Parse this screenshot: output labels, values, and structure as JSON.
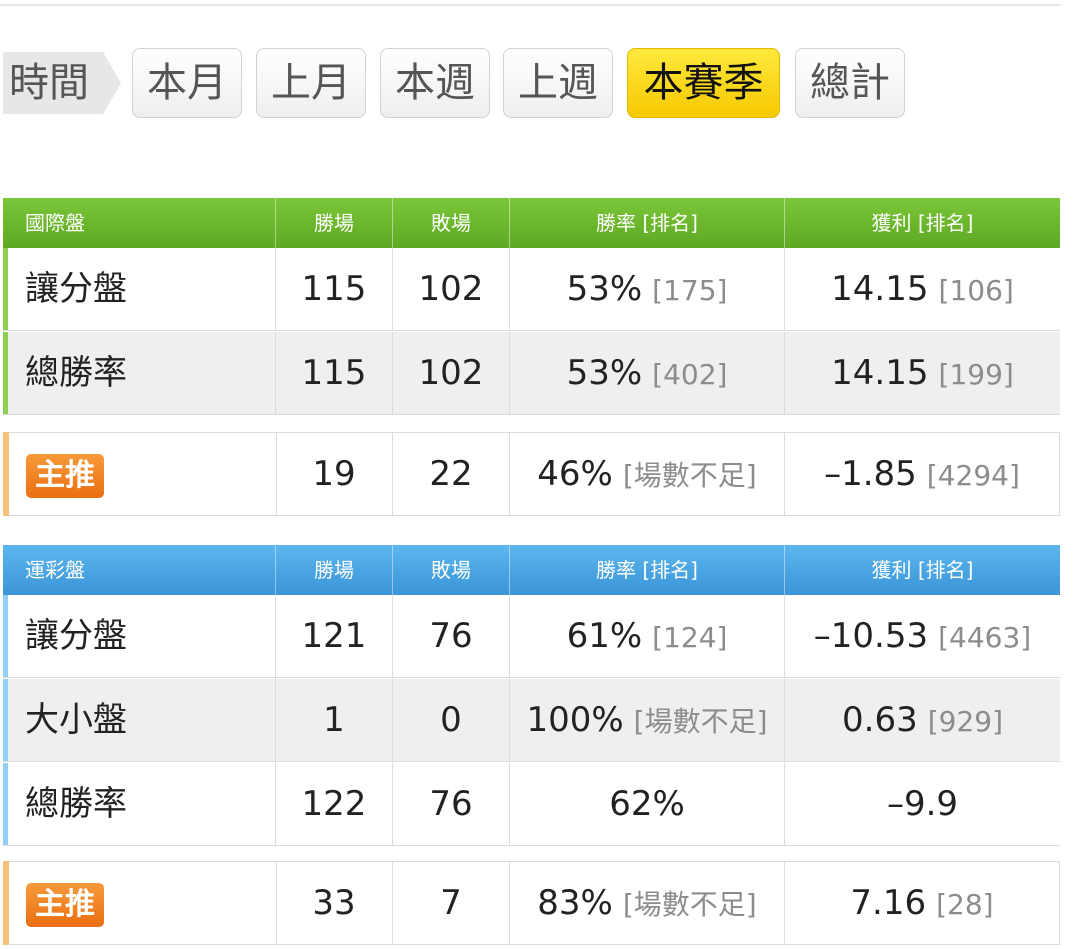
{
  "tabs": {
    "time_label": "時間",
    "items": [
      "本月",
      "上月",
      "本週",
      "上週",
      "本賽季",
      "總計"
    ],
    "active": "本賽季"
  },
  "tables": [
    {
      "header": [
        "國際盤",
        "勝場",
        "敗場",
        "勝率 [排名]",
        "獲利 [排名]"
      ],
      "color": "#6cb62e",
      "accent": "#8dd050",
      "rows": [
        {
          "label": "讓分盤",
          "wins": "115",
          "losses": "102",
          "rate": "53%",
          "rate_rank": "[175]",
          "profit": "14.15",
          "profit_rank": "[106]"
        },
        {
          "label": "總勝率",
          "wins": "115",
          "losses": "102",
          "rate": "53%",
          "rate_rank": "[402]",
          "profit": "14.15",
          "profit_rank": "[199]"
        }
      ],
      "featured": {
        "label": "主推",
        "wins": "19",
        "losses": "22",
        "rate": "46%",
        "rate_rank": "[場數不足]",
        "profit": "–1.85",
        "profit_rank": "[4294]"
      }
    },
    {
      "header": [
        "運彩盤",
        "勝場",
        "敗場",
        "勝率 [排名]",
        "獲利 [排名]"
      ],
      "color": "#4aa5e4",
      "accent": "#8fd0f4",
      "rows": [
        {
          "label": "讓分盤",
          "wins": "121",
          "losses": "76",
          "rate": "61%",
          "rate_rank": "[124]",
          "profit": "–10.53",
          "profit_rank": "[4463]"
        },
        {
          "label": "大小盤",
          "wins": "1",
          "losses": "0",
          "rate": "100%",
          "rate_rank": "[場數不足]",
          "profit": "0.63",
          "profit_rank": "[929]"
        },
        {
          "label": "總勝率",
          "wins": "122",
          "losses": "76",
          "rate": "62%",
          "rate_rank": "",
          "profit": "–9.9",
          "profit_rank": ""
        }
      ],
      "featured": {
        "label": "主推",
        "wins": "33",
        "losses": "7",
        "rate": "83%",
        "rate_rank": "[場數不足]",
        "profit": "7.16",
        "profit_rank": "[28]"
      }
    }
  ],
  "colors": {
    "active_tab": "#f6c900",
    "green_header": "#6cb62e",
    "blue_header": "#4aa5e4",
    "featured_badge": "#ea6f11",
    "featured_bar": "#f6c27a"
  }
}
